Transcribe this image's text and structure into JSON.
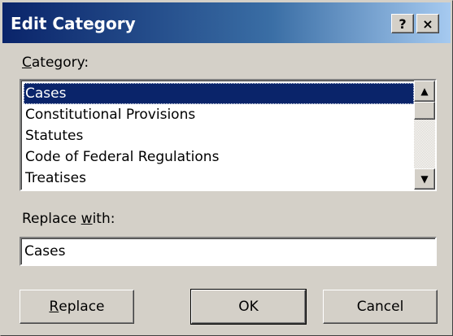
{
  "window": {
    "title": "Edit Category",
    "help_label": "?",
    "close_label": "×"
  },
  "category": {
    "label_access": "C",
    "label_rest": "ategory:",
    "items": [
      {
        "label": "Cases",
        "selected": true
      },
      {
        "label": "Constitutional Provisions",
        "selected": false
      },
      {
        "label": "Statutes",
        "selected": false
      },
      {
        "label": "Code of Federal Regulations",
        "selected": false
      },
      {
        "label": "Treatises",
        "selected": false
      }
    ],
    "scroll_up_icon": "▲",
    "scroll_down_icon": "▼"
  },
  "replace_with": {
    "label_pre": "Replace ",
    "label_access": "w",
    "label_post": "ith:",
    "value": "Cases"
  },
  "buttons": {
    "replace_access": "R",
    "replace_rest": "eplace",
    "ok": "OK",
    "cancel": "Cancel"
  },
  "colors": {
    "selection": "#0a246a",
    "face": "#d4d0c8"
  }
}
